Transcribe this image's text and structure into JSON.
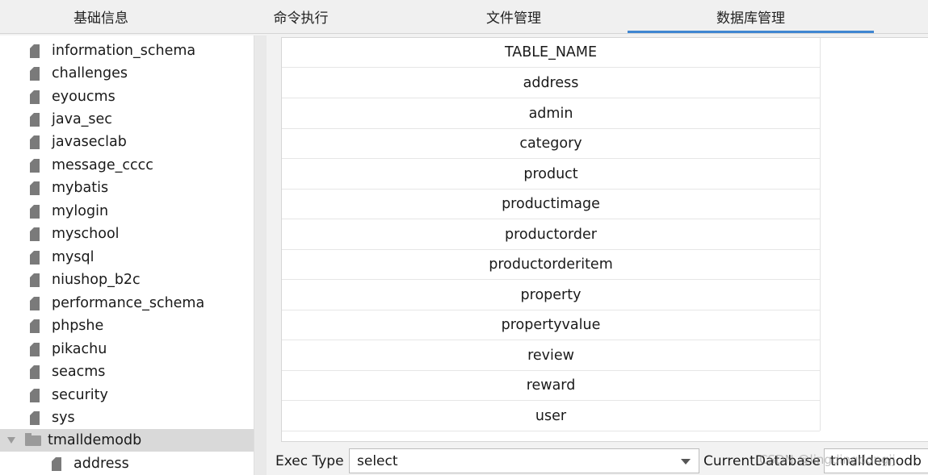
{
  "tabs": [
    {
      "label": "基础信息"
    },
    {
      "label": "命令执行"
    },
    {
      "label": "文件管理"
    },
    {
      "label": "数据库管理",
      "active": true
    }
  ],
  "tree": {
    "databases": [
      "information_schema",
      "challenges",
      "eyoucms",
      "java_sec",
      "javaseclab",
      "message_cccc",
      "mybatis",
      "mylogin",
      "myschool",
      "mysql",
      "niushop_b2c",
      "performance_schema",
      "phpshe",
      "pikachu",
      "seacms",
      "security",
      "sys"
    ],
    "expanded": {
      "name": "tmalldemodb",
      "children": [
        "address"
      ]
    }
  },
  "result_table": {
    "header": "TABLE_NAME",
    "rows": [
      "address",
      "admin",
      "category",
      "product",
      "productimage",
      "productorder",
      "productorderitem",
      "property",
      "propertyvalue",
      "review",
      "reward",
      "user"
    ]
  },
  "bottom": {
    "exec_type_label": "Exec Type",
    "exec_type_value": "select",
    "current_db_label": "CurrentDatabase",
    "current_db_value": "tmalldemodb"
  },
  "watermark": "CSDN @lingdingdongjj",
  "colors": {
    "accent": "#3f86d1",
    "selection": "#d9d9d9"
  }
}
